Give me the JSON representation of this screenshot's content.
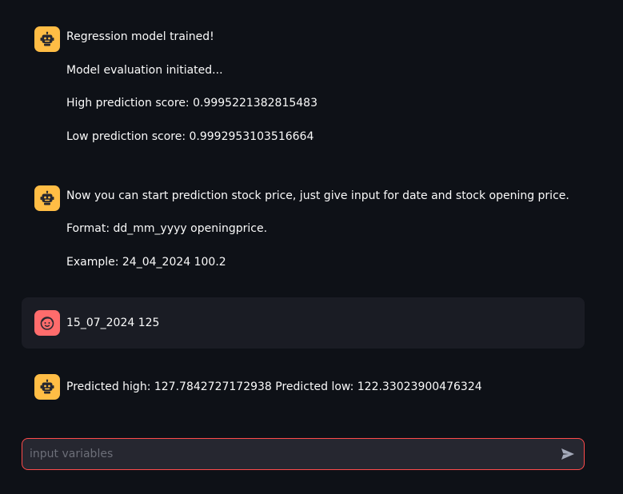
{
  "messages": [
    {
      "role": "assistant",
      "avatar_icon": "robot-icon",
      "lines": [
        "Regression model trained!",
        "Model evaluation initiated...",
        "High prediction score: 0.9995221382815483",
        "Low prediction score: 0.9992953103516664"
      ]
    },
    {
      "role": "assistant",
      "avatar_icon": "robot-icon",
      "lines": [
        "Now you can start prediction stock price, just give input for date and stock opening price.",
        "Format: dd_mm_yyyy openingprice.",
        "Example: 24_04_2024 100.2"
      ]
    },
    {
      "role": "user",
      "avatar_icon": "smiley-face-icon",
      "lines": [
        "15_07_2024 125"
      ]
    },
    {
      "role": "assistant",
      "avatar_icon": "robot-icon",
      "lines": [
        "Predicted high: 127.7842727172938 Predicted low: 122.33023900476324"
      ]
    }
  ],
  "chat_input": {
    "placeholder": "input variables",
    "value": "",
    "send_icon": "send-arrow-icon"
  },
  "colors": {
    "background": "#0e1117",
    "user_message_bg": "#1a1c24",
    "assistant_avatar": "#ffbd45",
    "user_avatar": "#ff6c6c",
    "input_border_focus": "#ff4b4b",
    "input_bg": "#262730"
  }
}
